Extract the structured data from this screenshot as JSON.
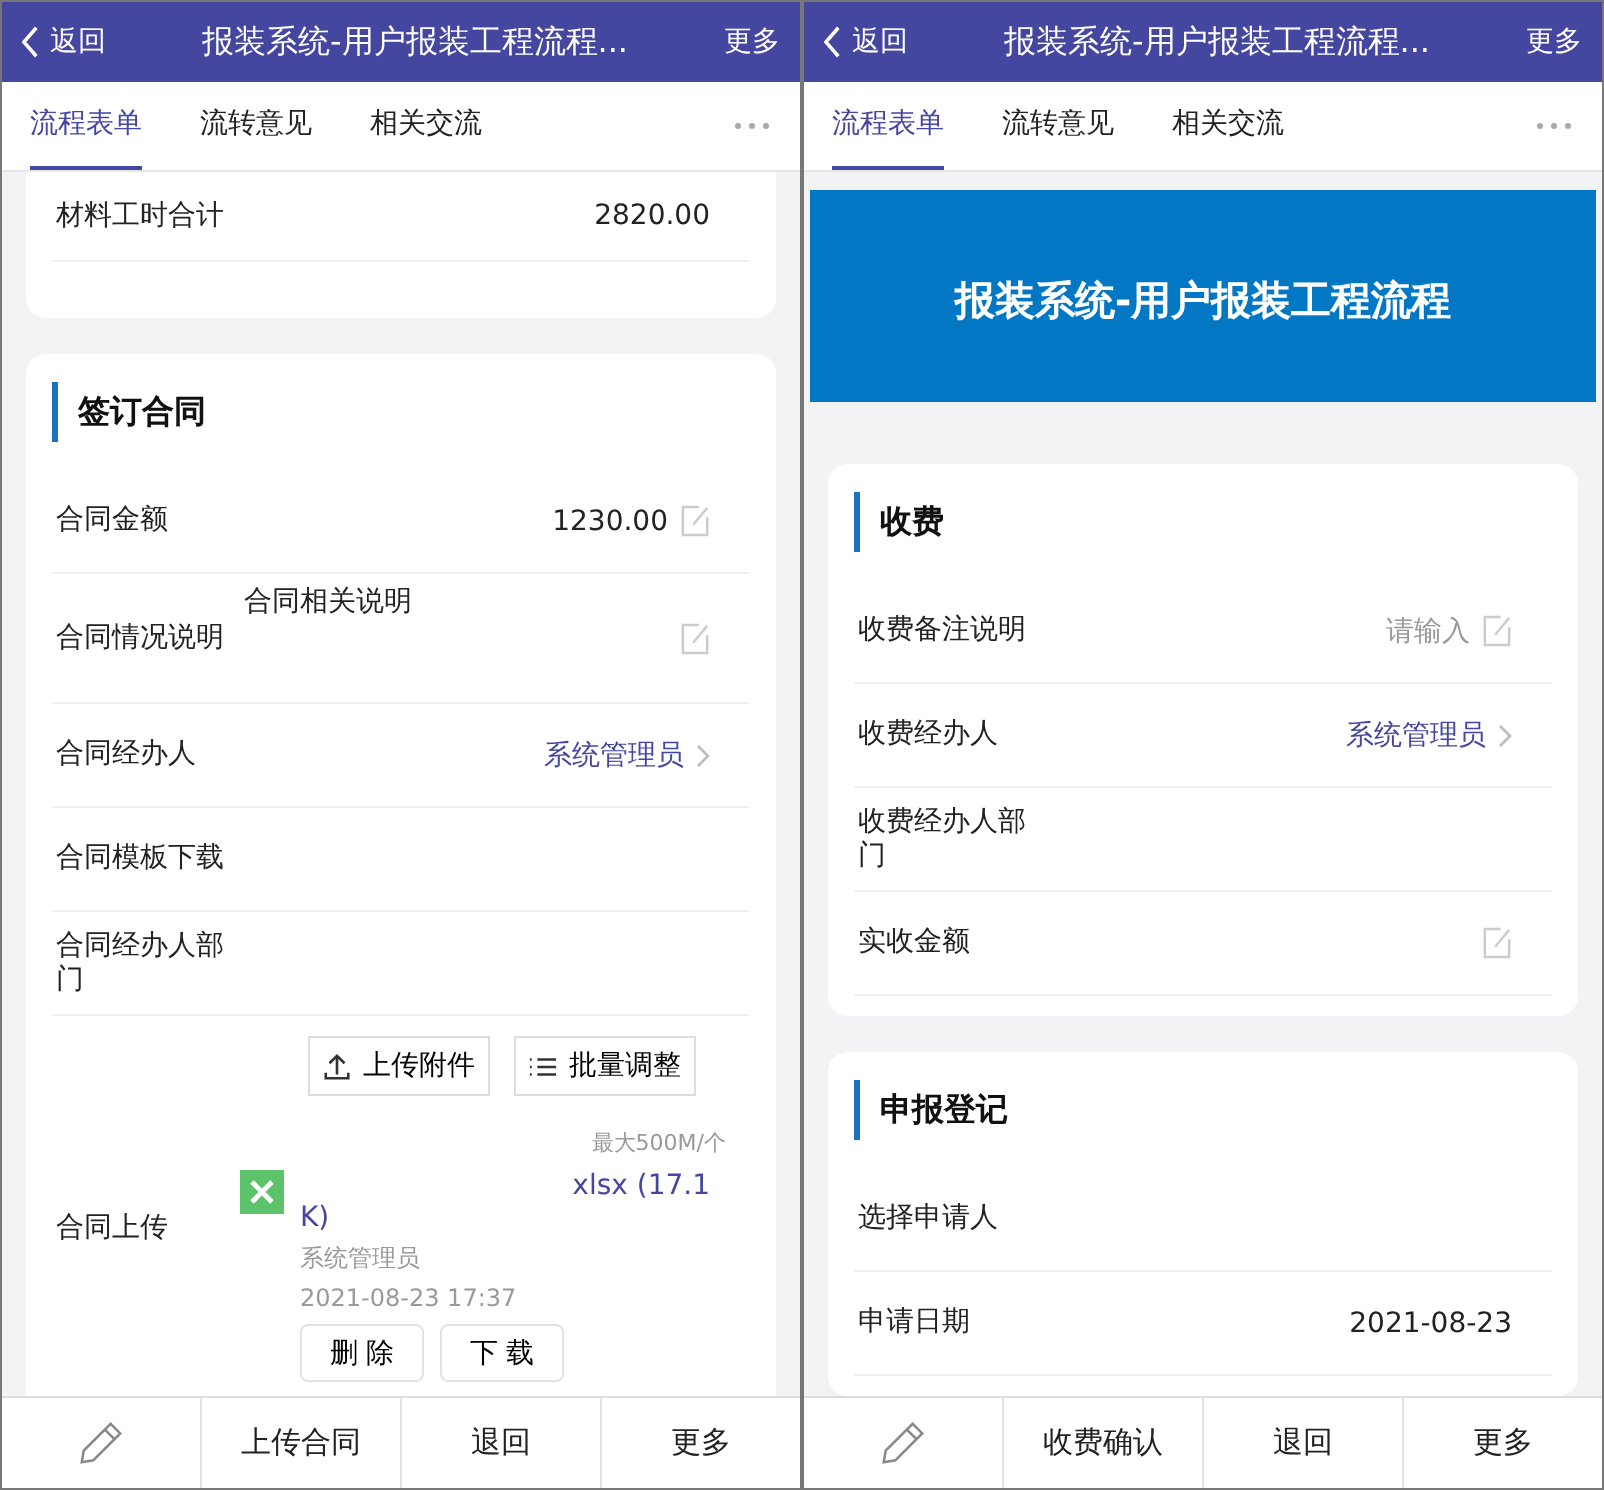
{
  "panels": [
    {
      "header": {
        "back": "返回",
        "title": "报装系统-用户报装工程流程...",
        "more": "更多"
      },
      "tabs": [
        {
          "label": "流程表单",
          "selected": true
        },
        {
          "label": "流转意见",
          "selected": false
        },
        {
          "label": "相关交流",
          "selected": false
        }
      ],
      "sections": [
        {
          "cut_top": true,
          "rows": [
            {
              "kind": "value",
              "label": "材料工时合计",
              "value": "2820.00"
            }
          ]
        },
        {
          "title": "签订合同",
          "rows": [
            {
              "kind": "edit",
              "label": "合同金额",
              "value": "1230.00"
            },
            {
              "kind": "edit",
              "label": "合同情况说明",
              "hint": "合同相关说明"
            },
            {
              "kind": "picker",
              "label": "合同经办人",
              "value": "系统管理员"
            },
            {
              "kind": "plain",
              "label": "合同模板下载"
            },
            {
              "kind": "plain",
              "label": "合同经办人部门"
            },
            {
              "kind": "actions",
              "buttons": [
                "上传附件",
                "批量调整"
              ]
            },
            {
              "kind": "upload",
              "label": "合同上传",
              "limit": "最大500M/个",
              "file_name": "xlsx (17.1",
              "file_name_rest": "K)",
              "uploader": "系统管理员",
              "time": "2021-08-23 17:37",
              "buttons": [
                "删 除",
                "下 载"
              ]
            }
          ]
        }
      ],
      "bottom_buttons": [
        "上传合同",
        "退回",
        "更多"
      ]
    },
    {
      "header": {
        "back": "返回",
        "title": "报装系统-用户报装工程流程...",
        "more": "更多"
      },
      "tabs": [
        {
          "label": "流程表单",
          "selected": true
        },
        {
          "label": "流转意见",
          "selected": false
        },
        {
          "label": "相关交流",
          "selected": false
        }
      ],
      "banner": "报装系统-用户报装工程流程",
      "sections": [
        {
          "title": "收费",
          "rows": [
            {
              "kind": "edit",
              "label": "收费备注说明",
              "placeholder": "请输入"
            },
            {
              "kind": "picker",
              "label": "收费经办人",
              "value": "系统管理员"
            },
            {
              "kind": "plain",
              "label": "收费经办人部门"
            },
            {
              "kind": "edit",
              "label": "实收金额"
            }
          ]
        },
        {
          "title": "申报登记",
          "rows": [
            {
              "kind": "plain",
              "label": "选择申请人"
            },
            {
              "kind": "value",
              "label": "申请日期",
              "value": "2021-08-23"
            }
          ]
        }
      ],
      "bottom_buttons": [
        "收费确认",
        "退回",
        "更多"
      ]
    }
  ]
}
